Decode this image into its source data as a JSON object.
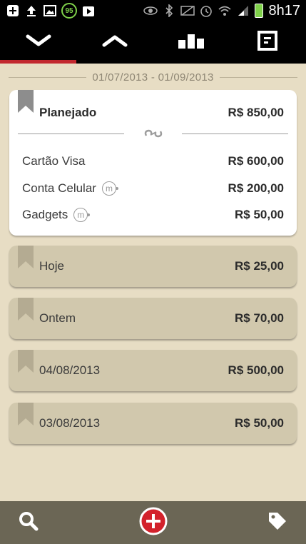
{
  "status_bar": {
    "badge": "95",
    "time": "8h17"
  },
  "date_range": "01/07/2013 - 01/09/2013",
  "planned": {
    "title": "Planejado",
    "total": "R$ 850,00",
    "items": [
      {
        "name": "Cartão  Visa",
        "amount": "R$ 600,00",
        "has_m_icon": false
      },
      {
        "name": "Conta Celular",
        "amount": "R$ 200,00",
        "has_m_icon": true
      },
      {
        "name": "Gadgets",
        "amount": "R$ 50,00",
        "has_m_icon": true
      }
    ]
  },
  "days": [
    {
      "label": "Hoje",
      "amount": "R$ 25,00"
    },
    {
      "label": "Ontem",
      "amount": "R$ 70,00"
    },
    {
      "label": "04/08/2013",
      "amount": "R$ 500,00"
    },
    {
      "label": "03/08/2013",
      "amount": "R$ 50,00"
    }
  ],
  "m_icon_letter": "m",
  "colors": {
    "background": "#e7ddc4",
    "accent": "#c2282f",
    "day_card": "#d1c8ad",
    "bottom_bar": "#6b6655"
  }
}
